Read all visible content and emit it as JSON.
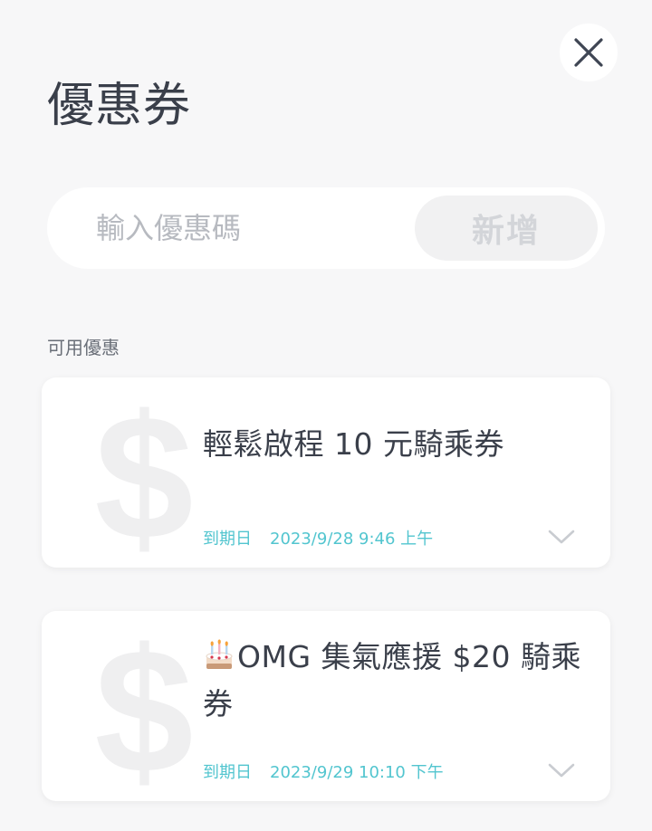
{
  "header": {
    "title": "優惠券",
    "close_icon": "close-icon"
  },
  "promo": {
    "placeholder": "輸入優惠碼",
    "add_label": "新增"
  },
  "section": {
    "label": "可用優惠"
  },
  "coupons": [
    {
      "icon": "dollar-icon",
      "title": "輕鬆啟程 10 元騎乘券",
      "expiry_label": "到期日",
      "expiry_date": "2023/9/28 9:46 上午"
    },
    {
      "icon": "dollar-icon",
      "emoji": "cake-icon",
      "title": "OMG 集氣應援 $20 騎乘券",
      "expiry_label": "到期日",
      "expiry_date": "2023/9/29 10:10 下午"
    }
  ],
  "colors": {
    "background": "#f7f7f8",
    "accent": "#52c5cf",
    "text": "#3a3f4a",
    "dollar_watermark": "#efeff0"
  }
}
